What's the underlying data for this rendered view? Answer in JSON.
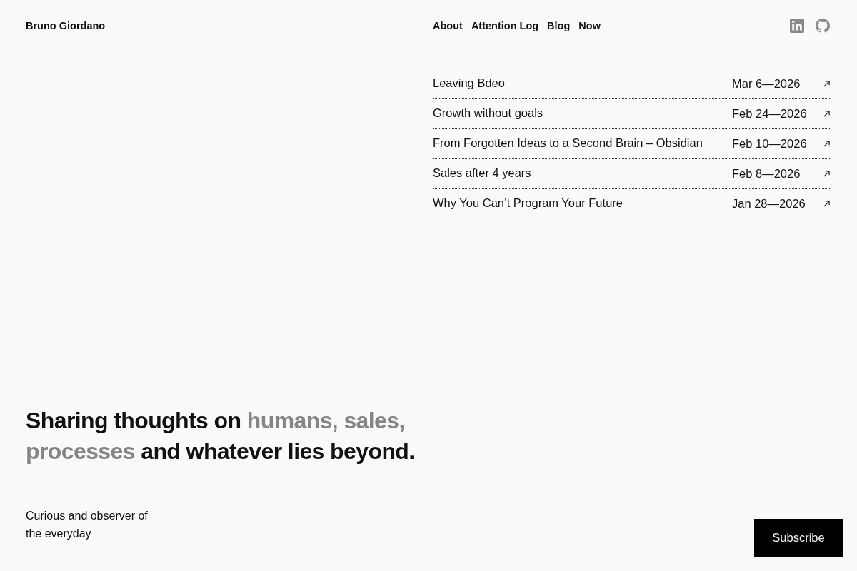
{
  "header": {
    "site_title": "Bruno Giordano",
    "nav": [
      "About",
      "Attention Log",
      "Blog",
      "Now"
    ]
  },
  "posts": [
    {
      "title": "Leaving Bdeo",
      "date": "Mar 6—2026"
    },
    {
      "title": "Growth without goals",
      "date": "Feb 24—2026"
    },
    {
      "title": "From Forgotten Ideas to a Second Brain – Obsidian",
      "date": "Feb 10—2026"
    },
    {
      "title": "Sales after 4 years",
      "date": "Feb 8—2026"
    },
    {
      "title": "Why You Can’t Program Your Future",
      "date": "Jan 28—2026"
    }
  ],
  "hero": {
    "headline": [
      {
        "text": "Sharing thoughts on ",
        "muted": false
      },
      {
        "text": "humans, sales, processes",
        "muted": true
      },
      {
        "text": " and whatever lies beyond.",
        "muted": false
      }
    ],
    "tagline": "Curious and observer of the everyday"
  },
  "subscribe_button": "Subscribe"
}
